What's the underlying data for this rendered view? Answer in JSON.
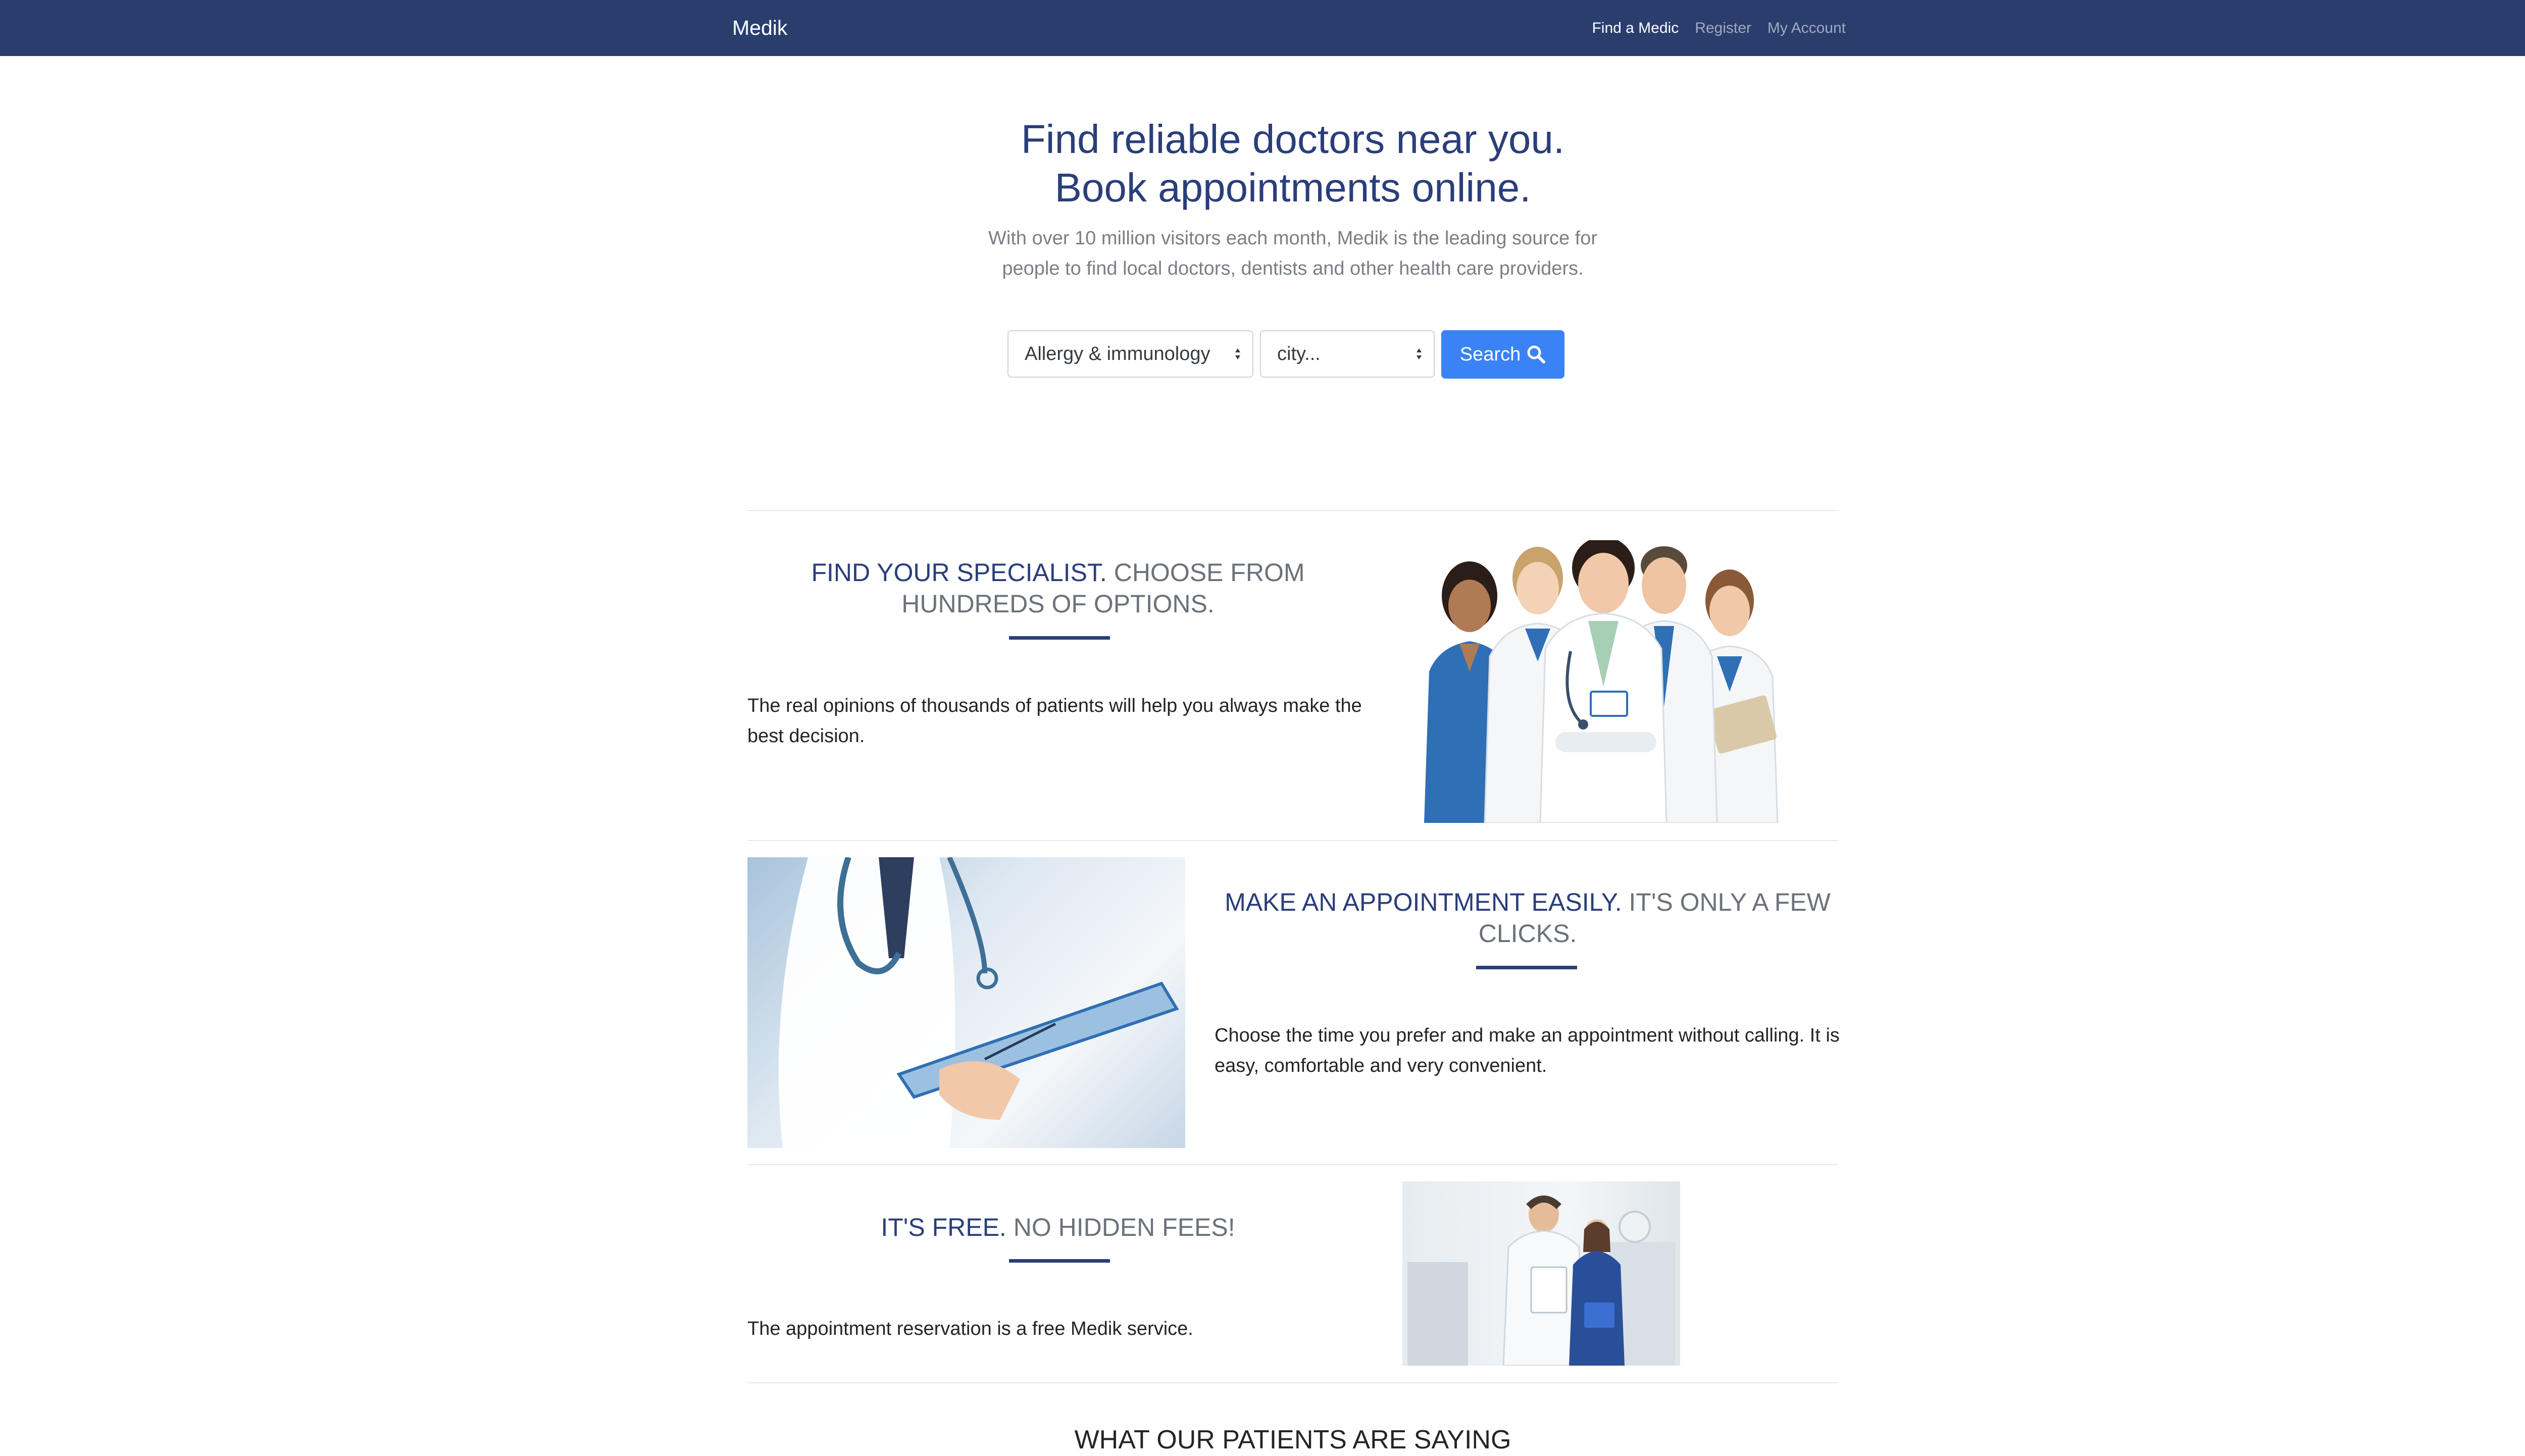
{
  "navbar": {
    "brand": "Medik",
    "links": [
      {
        "label": "Find a Medic",
        "active": true
      },
      {
        "label": "Register",
        "active": false
      },
      {
        "label": "My Account",
        "active": false
      }
    ]
  },
  "hero": {
    "title_line1": "Find reliable doctors near you.",
    "title_line2": "Book appointments online.",
    "subtitle": "With over 10 million visitors each month, Medik is the leading source for people to find local doctors, dentists and other health care providers.",
    "specialty_selected": "Allergy & immunology",
    "city_selected": "city...",
    "search_label": "Search",
    "search_icon": "search-icon"
  },
  "features": [
    {
      "title_strong": "FIND YOUR SPECIALIST.",
      "title_rest": " CHOOSE FROM HUNDREDS OF OPTIONS.",
      "text": "The real opinions of thousands of patients will help you always make the best decision.",
      "image": "group of doctors"
    },
    {
      "title_strong": "MAKE AN APPOINTMENT EASILY.",
      "title_rest": " IT'S ONLY A FEW CLICKS.",
      "text": "Choose the time you prefer and make an appointment without calling. It is easy, comfortable and very convenient.",
      "image": "doctor writing on clipboard"
    },
    {
      "title_strong": "IT'S FREE.",
      "title_rest": " NO HIDDEN FEES!",
      "text": "The appointment reservation is a free Medik service.",
      "image": "two dentists in clinic"
    }
  ],
  "testimonials": {
    "title_part1": "WHAT ",
    "title_strong": "OUR PATIENTS",
    "title_part2": " ARE SAYING"
  },
  "colors": {
    "navbar": "#2a3e6e",
    "accent_blue": "#2a3e7a",
    "button_blue": "#3b82f6"
  }
}
